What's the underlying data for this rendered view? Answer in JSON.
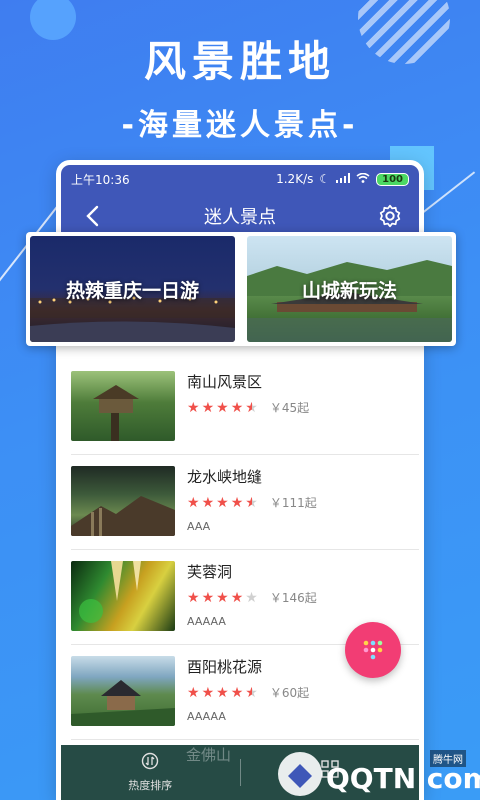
{
  "promo": {
    "headline": "风景胜地",
    "subline": "-海量迷人景点-"
  },
  "statusbar": {
    "time": "上午10:36",
    "net_speed": "1.2K/s",
    "battery": "100"
  },
  "appbar": {
    "title": "迷人景点",
    "back_icon": "back-arrow-icon",
    "settings_icon": "gear-icon"
  },
  "banners": [
    {
      "label": "热辣重庆一日游"
    },
    {
      "label": "山城新玩法"
    }
  ],
  "spots": [
    {
      "name": "南山风景区",
      "rating": 4.5,
      "price": "￥45起",
      "tag": ""
    },
    {
      "name": "龙水峡地缝",
      "rating": 4.5,
      "price": "￥111起",
      "tag": "AAA"
    },
    {
      "name": "芙蓉洞",
      "rating": 4,
      "price": "￥146起",
      "tag": "AAAAA"
    },
    {
      "name": "酉阳桃花源",
      "rating": 4.5,
      "price": "￥60起",
      "tag": "AAAAA"
    }
  ],
  "partial_spot": {
    "name": "金佛山"
  },
  "bottom_nav": {
    "tabs": [
      {
        "label": "热度排序",
        "icon": "sort-icon"
      },
      {
        "label": "",
        "icon": "grid-icon"
      }
    ]
  },
  "watermark": {
    "site": "QQTN.com",
    "label": "腾牛网"
  },
  "colors": {
    "background": "#3d8ff5",
    "appbar": "#3f57b8",
    "star": "#f0504a",
    "fab": "#f23d74",
    "bottom_nav": "#264b45"
  }
}
